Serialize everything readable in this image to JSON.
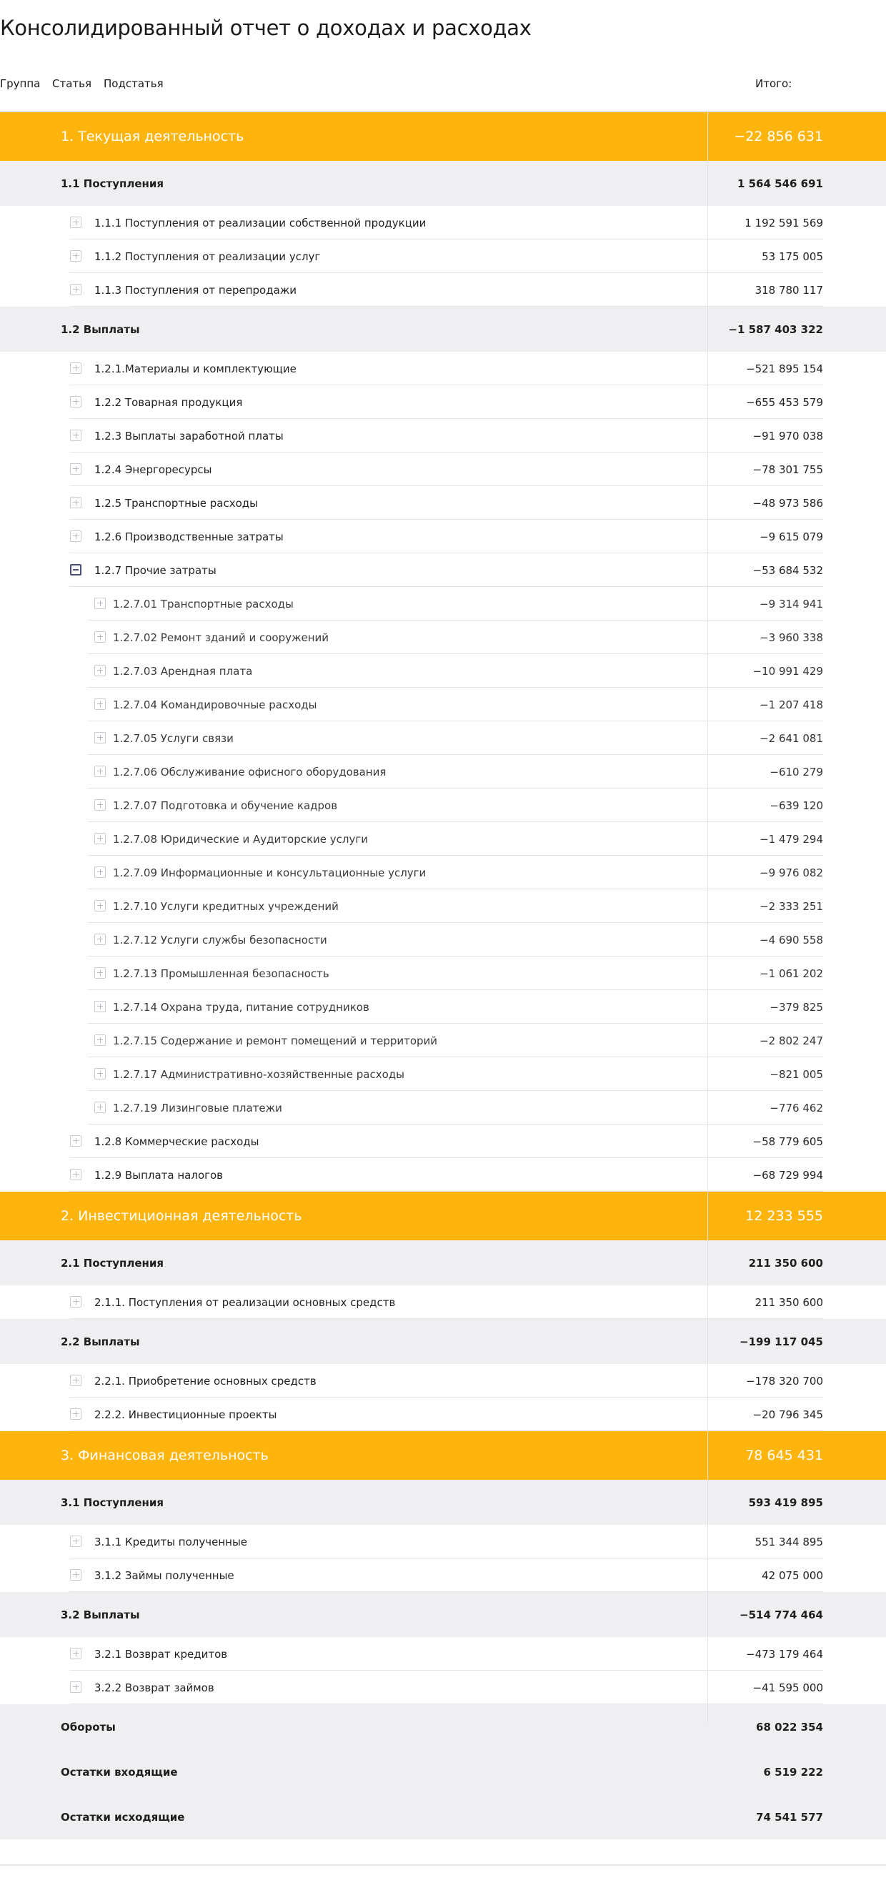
{
  "report": {
    "title": "Консолидированный отчет о доходах и расходах",
    "headers": {
      "group": "Группа",
      "article": "Статья",
      "subarticle": "Подстатья",
      "total": "Итого:"
    }
  },
  "rows": [
    {
      "type": "section",
      "label": "1. Текущая деятельность",
      "value": "−22 856 631"
    },
    {
      "type": "subsection",
      "label": "1.1 Поступления",
      "value": "1 564 546 691"
    },
    {
      "type": "item",
      "level": 1,
      "expanded": false,
      "label": "1.1.1 Поступления от  реализации собственной продукции",
      "value": "1 192 591 569"
    },
    {
      "type": "item",
      "level": 1,
      "expanded": false,
      "label": "1.1.2 Поступления от  реализации услуг",
      "value": "53 175 005"
    },
    {
      "type": "item",
      "level": 1,
      "expanded": false,
      "label": "1.1.3 Поступления от  перепродажи",
      "value": "318 780 117"
    },
    {
      "type": "subsection",
      "label": "1.2 Выплаты",
      "value": "−1 587 403 322"
    },
    {
      "type": "item",
      "level": 1,
      "expanded": false,
      "label": "1.2.1.Материалы и комплектующие",
      "value": "−521 895 154"
    },
    {
      "type": "item",
      "level": 1,
      "expanded": false,
      "label": "1.2.2 Товарная продукция",
      "value": "−655 453 579"
    },
    {
      "type": "item",
      "level": 1,
      "expanded": false,
      "label": "1.2.3 Выплаты заработной платы",
      "value": "−91 970 038"
    },
    {
      "type": "item",
      "level": 1,
      "expanded": false,
      "label": "1.2.4 Энергоресурсы",
      "value": "−78 301 755"
    },
    {
      "type": "item",
      "level": 1,
      "expanded": false,
      "label": "1.2.5 Транспортные расходы",
      "value": "−48 973 586"
    },
    {
      "type": "item",
      "level": 1,
      "expanded": false,
      "label": "1.2.6 Производственные затраты",
      "value": "−9 615 079"
    },
    {
      "type": "item",
      "level": 1,
      "expanded": true,
      "label": "1.2.7 Прочие затраты",
      "value": "−53 684 532"
    },
    {
      "type": "item",
      "level": 2,
      "expanded": false,
      "label": "1.2.7.01 Транспортные расходы",
      "value": "−9 314 941"
    },
    {
      "type": "item",
      "level": 2,
      "expanded": false,
      "label": "1.2.7.02 Ремонт зданий и сооружений",
      "value": "−3 960 338"
    },
    {
      "type": "item",
      "level": 2,
      "expanded": false,
      "label": "1.2.7.03 Арендная плата",
      "value": "−10 991 429"
    },
    {
      "type": "item",
      "level": 2,
      "expanded": false,
      "label": "1.2.7.04 Командировочные расходы",
      "value": "−1 207 418"
    },
    {
      "type": "item",
      "level": 2,
      "expanded": false,
      "label": "1.2.7.05 Услуги связи",
      "value": "−2 641 081"
    },
    {
      "type": "item",
      "level": 2,
      "expanded": false,
      "label": "1.2.7.06 Обслуживание офисного оборудования",
      "value": "−610 279"
    },
    {
      "type": "item",
      "level": 2,
      "expanded": false,
      "label": "1.2.7.07 Подготовка и обучение кадров",
      "value": "−639 120"
    },
    {
      "type": "item",
      "level": 2,
      "expanded": false,
      "label": "1.2.7.08 Юридические и Аудиторские услуги",
      "value": "−1 479 294"
    },
    {
      "type": "item",
      "level": 2,
      "expanded": false,
      "label": "1.2.7.09 Информационные и консультационные  услуги",
      "value": "−9 976 082"
    },
    {
      "type": "item",
      "level": 2,
      "expanded": false,
      "label": "1.2.7.10  Услуги кредитных учреждений",
      "value": "−2 333 251"
    },
    {
      "type": "item",
      "level": 2,
      "expanded": false,
      "label": "1.2.7.12 Услуги службы безопасности",
      "value": "−4 690 558"
    },
    {
      "type": "item",
      "level": 2,
      "expanded": false,
      "label": "1.2.7.13 Промышленная безопасность",
      "value": "−1 061 202"
    },
    {
      "type": "item",
      "level": 2,
      "expanded": false,
      "label": "1.2.7.14 Охрана труда, питание сотрудников",
      "value": "−379 825"
    },
    {
      "type": "item",
      "level": 2,
      "expanded": false,
      "label": "1.2.7.15 Содержание и ремонт  помещений и территорий",
      "value": "−2 802 247"
    },
    {
      "type": "item",
      "level": 2,
      "expanded": false,
      "label": "1.2.7.17 Административно-хозяйственные расходы",
      "value": "−821 005"
    },
    {
      "type": "item",
      "level": 2,
      "expanded": false,
      "label": "1.2.7.19 Лизинговые платежи",
      "value": "−776 462"
    },
    {
      "type": "item",
      "level": 1,
      "expanded": false,
      "label": "1.2.8 Коммерческие расходы",
      "value": "−58 779 605"
    },
    {
      "type": "item",
      "level": 1,
      "expanded": false,
      "label": "1.2.9 Выплата налогов",
      "value": "−68 729 994"
    },
    {
      "type": "section",
      "label": "2. Инвестиционная деятельность",
      "value": "12 233 555"
    },
    {
      "type": "subsection",
      "label": "2.1 Поступления",
      "value": "211 350 600"
    },
    {
      "type": "item",
      "level": 1,
      "expanded": false,
      "label": "2.1.1. Поступления от реализации основных средств",
      "value": "211 350 600"
    },
    {
      "type": "subsection",
      "label": "2.2 Выплаты",
      "value": "−199 117 045"
    },
    {
      "type": "item",
      "level": 1,
      "expanded": false,
      "label": "2.2.1. Приобретение основных средств",
      "value": "−178 320 700"
    },
    {
      "type": "item",
      "level": 1,
      "expanded": false,
      "label": "2.2.2. Инвестиционные проекты",
      "value": "−20 796 345"
    },
    {
      "type": "section",
      "label": "3. Финансовая деятельность",
      "value": "78 645 431"
    },
    {
      "type": "subsection",
      "label": "3.1 Поступления",
      "value": "593 419 895"
    },
    {
      "type": "item",
      "level": 1,
      "expanded": false,
      "label": "3.1.1 Кредиты полученные",
      "value": "551 344 895"
    },
    {
      "type": "item",
      "level": 1,
      "expanded": false,
      "label": "3.1.2 Займы полученные",
      "value": "42 075 000"
    },
    {
      "type": "subsection",
      "label": "3.2 Выплаты",
      "value": "−514 774 464"
    },
    {
      "type": "item",
      "level": 1,
      "expanded": false,
      "label": "3.2.1  Возврат  кредитов",
      "value": "−473 179 464"
    },
    {
      "type": "item",
      "level": 1,
      "expanded": false,
      "label": "3.2.2  Возврат  займов",
      "value": "−41 595 000"
    },
    {
      "type": "summary",
      "label": "Обороты",
      "value": "68 022 354"
    },
    {
      "type": "summary",
      "label": "Остатки входящие",
      "value": "6 519 222"
    },
    {
      "type": "summary",
      "label": "Остатки исходящие",
      "value": "74 541 577"
    }
  ]
}
